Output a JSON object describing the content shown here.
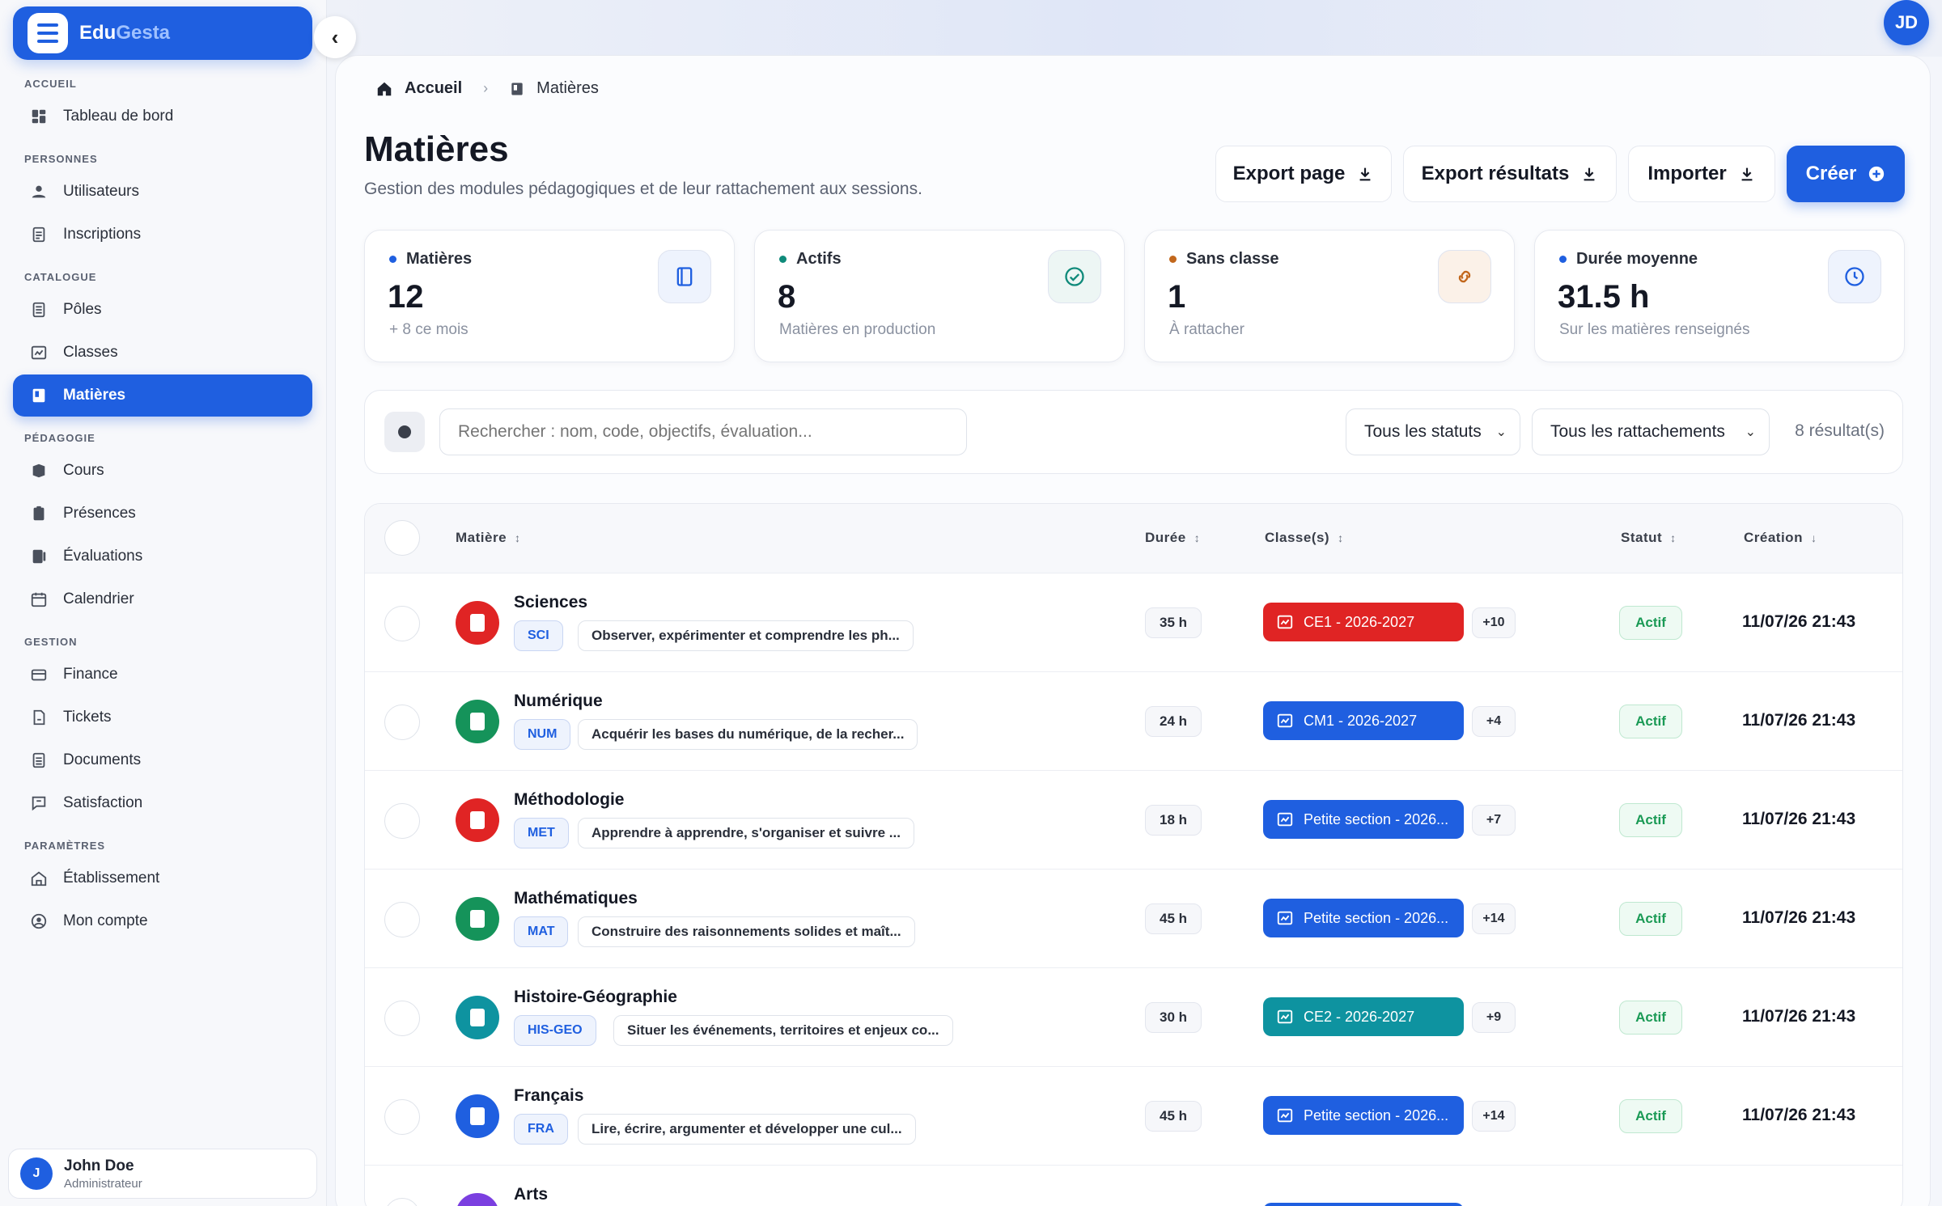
{
  "brand": {
    "name_part1": "Edu",
    "name_part2": "Gesta"
  },
  "sidebar": {
    "sections": [
      {
        "title": "ACCUEIL",
        "items": [
          {
            "label": "Tableau de bord",
            "icon": "dashboard-icon"
          }
        ]
      },
      {
        "title": "PERSONNES",
        "items": [
          {
            "label": "Utilisateurs",
            "icon": "users-icon"
          },
          {
            "label": "Inscriptions",
            "icon": "file-icon"
          }
        ]
      },
      {
        "title": "CATALOGUE",
        "items": [
          {
            "label": "Pôles",
            "icon": "list-icon"
          },
          {
            "label": "Classes",
            "icon": "class-icon"
          },
          {
            "label": "Matières",
            "icon": "book-icon",
            "active": true
          }
        ]
      },
      {
        "title": "PÉDAGOGIE",
        "items": [
          {
            "label": "Cours",
            "icon": "course-icon"
          },
          {
            "label": "Présences",
            "icon": "clipboard-icon"
          },
          {
            "label": "Évaluations",
            "icon": "evaluation-icon"
          },
          {
            "label": "Calendrier",
            "icon": "calendar-icon"
          }
        ]
      },
      {
        "title": "GESTION",
        "items": [
          {
            "label": "Finance",
            "icon": "card-icon"
          },
          {
            "label": "Tickets",
            "icon": "ticket-icon"
          },
          {
            "label": "Documents",
            "icon": "document-icon"
          },
          {
            "label": "Satisfaction",
            "icon": "message-icon"
          }
        ]
      },
      {
        "title": "PARAMÈTRES",
        "items": [
          {
            "label": "Établissement",
            "icon": "building-icon"
          },
          {
            "label": "Mon compte",
            "icon": "account-icon"
          }
        ]
      }
    ]
  },
  "user": {
    "initial": "J",
    "name": "John Doe",
    "role": "Administrateur",
    "top_initials": "JD"
  },
  "breadcrumb": {
    "home": "Accueil",
    "current": "Matières"
  },
  "page": {
    "title": "Matières",
    "subtitle": "Gestion des modules pédagogiques et de leur rattachement aux sessions."
  },
  "actions": {
    "export_page": "Export page",
    "export_results": "Export résultats",
    "import": "Importer",
    "create": "Créer"
  },
  "stats": [
    {
      "label": "Matières",
      "value": "12",
      "sub": "+ 8 ce mois",
      "dot": "#1f5fe0",
      "icon": "book-icon",
      "icon_bg": "#eef3fd",
      "icon_color": "#1f5fe0"
    },
    {
      "label": "Actifs",
      "value": "8",
      "sub": "Matières en production",
      "dot": "#0f8a7a",
      "icon": "check-circle-icon",
      "icon_bg": "#edf6f4",
      "icon_color": "#0f8a7a"
    },
    {
      "label": "Sans classe",
      "value": "1",
      "sub": "À rattacher",
      "dot": "#c2671c",
      "icon": "link-icon",
      "icon_bg": "#fbf1e8",
      "icon_color": "#c2671c"
    },
    {
      "label": "Durée moyenne",
      "value": "31.5 h",
      "sub": "Sur les matières renseignés",
      "dot": "#1f5fe0",
      "icon": "clock-icon",
      "icon_bg": "#eef3fd",
      "icon_color": "#1f5fe0"
    }
  ],
  "filters": {
    "search_placeholder": "Rechercher : nom, code, objectifs, évaluation...",
    "status": "Tous les statuts",
    "attachment": "Tous les rattachements",
    "count": "8 résultat(s)"
  },
  "table": {
    "headers": {
      "subject": "Matière",
      "duration": "Durée",
      "classes": "Classe(s)",
      "status": "Statut",
      "created": "Création"
    },
    "rows": [
      {
        "name": "Sciences",
        "code": "SCI",
        "desc": "Observer, expérimenter et comprendre les ph...",
        "duration": "35 h",
        "class": "CE1 - 2026-2027",
        "class_color": "#e02424",
        "more": "+10",
        "status": "Actif",
        "created": "11/07/26 21:43",
        "icon_color": "#e02424"
      },
      {
        "name": "Numérique",
        "code": "NUM",
        "desc": "Acquérir les bases du numérique, de la recher...",
        "duration": "24 h",
        "class": "CM1 - 2026-2027",
        "class_color": "#1f5fe0",
        "more": "+4",
        "status": "Actif",
        "created": "11/07/26 21:43",
        "icon_color": "#15935a"
      },
      {
        "name": "Méthodologie",
        "code": "MET",
        "desc": "Apprendre à apprendre, s'organiser et suivre ...",
        "duration": "18 h",
        "class": "Petite section - 2026...",
        "class_color": "#1f5fe0",
        "more": "+7",
        "status": "Actif",
        "created": "11/07/26 21:43",
        "icon_color": "#e02424"
      },
      {
        "name": "Mathématiques",
        "code": "MAT",
        "desc": "Construire des raisonnements solides et maît...",
        "duration": "45 h",
        "class": "Petite section - 2026...",
        "class_color": "#1f5fe0",
        "more": "+14",
        "status": "Actif",
        "created": "11/07/26 21:43",
        "icon_color": "#15935a"
      },
      {
        "name": "Histoire-Géographie",
        "code": "HIS-GEO",
        "desc": "Situer les événements, territoires et enjeux co...",
        "duration": "30 h",
        "class": "CE2 - 2026-2027",
        "class_color": "#0e93a0",
        "more": "+9",
        "status": "Actif",
        "created": "11/07/26 21:43",
        "icon_color": "#0e93a0"
      },
      {
        "name": "Français",
        "code": "FRA",
        "desc": "Lire, écrire, argumenter et développer une cul...",
        "duration": "45 h",
        "class": "Petite section - 2026...",
        "class_color": "#1f5fe0",
        "more": "+14",
        "status": "Actif",
        "created": "11/07/26 21:43",
        "icon_color": "#1f5fe0"
      },
      {
        "name": "Arts",
        "code": "",
        "desc": "",
        "duration": "",
        "class": "",
        "class_color": "#1f5fe0",
        "more": "",
        "status": "",
        "created": "",
        "icon_color": "#7b3fe0"
      }
    ]
  }
}
